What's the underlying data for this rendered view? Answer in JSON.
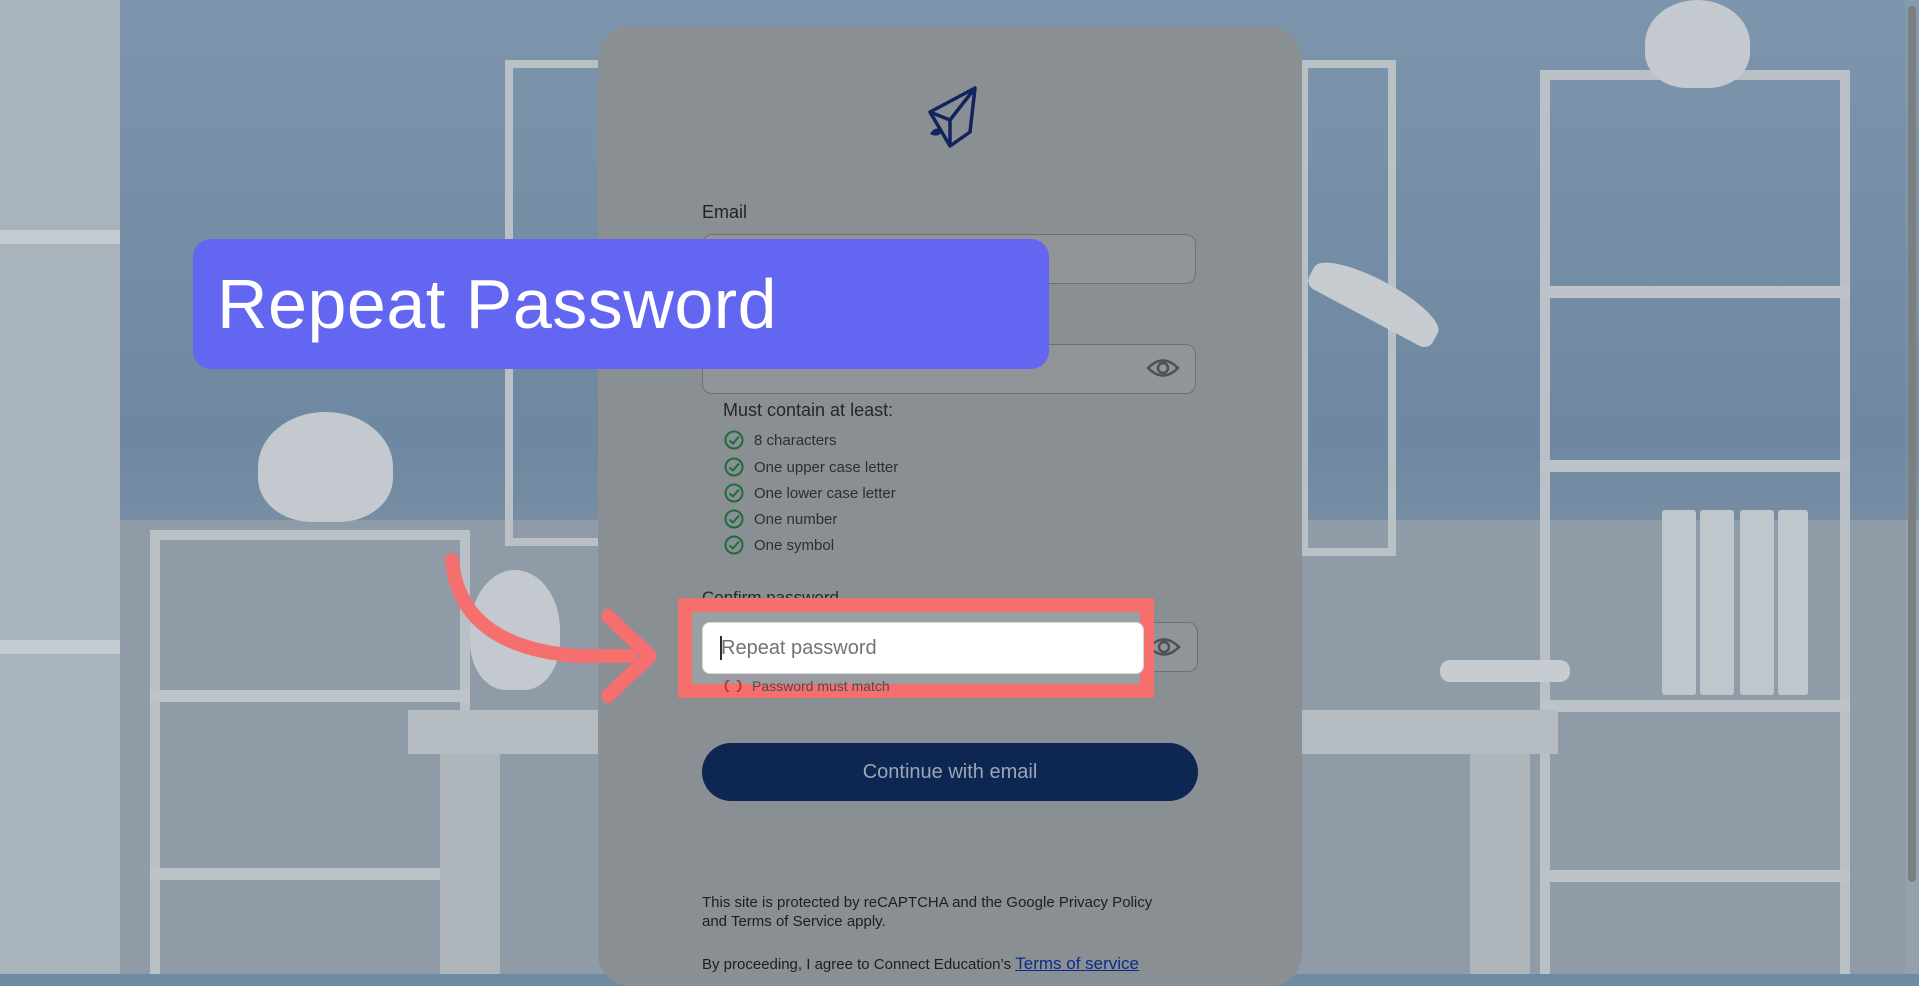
{
  "banner": {
    "title": "Repeat Password"
  },
  "form": {
    "email_label": "Email",
    "confirm_label": "Confirm password",
    "repeat_placeholder": "Repeat password",
    "rules_title": "Must contain at least:",
    "rules": [
      "8 characters",
      "One upper case letter",
      "One lower case letter",
      "One number",
      "One symbol"
    ],
    "error_text": "Password must match",
    "continue_label": "Continue with email"
  },
  "legal": {
    "recaptcha_prefix": "This site is protected by reCAPTCHA and the Google",
    "privacy_link": "Privacy Policy",
    "and_text": "and",
    "terms_link": "Terms of Service",
    "apply_text": "apply.",
    "agree_prefix": "By proceeding, I agree to Connect Education’s",
    "terms_of_service_link": "Terms of service"
  },
  "colors": {
    "banner": "#6366f1",
    "highlight": "#f56f6f",
    "button": "#0e2652",
    "check": "#1f6b3a"
  },
  "icons": [
    "logo-icon",
    "eye-icon",
    "check-circle-icon",
    "error-circle-icon",
    "arrow-icon"
  ]
}
